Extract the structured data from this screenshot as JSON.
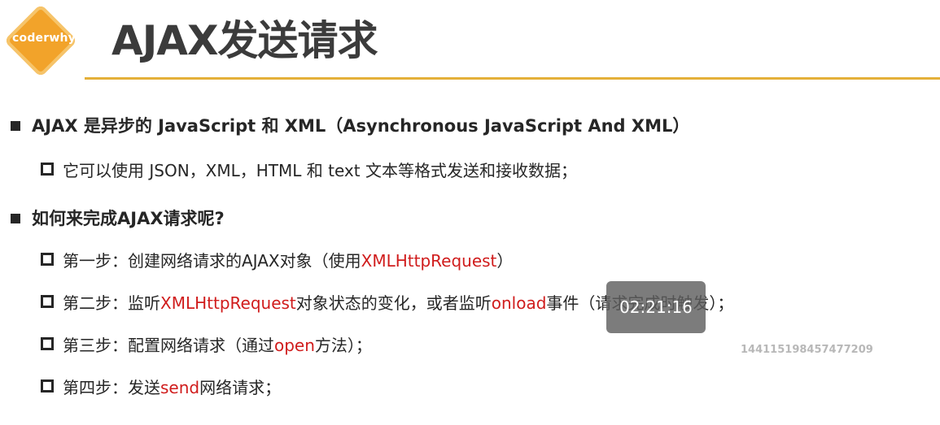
{
  "logo": {
    "text": "coderwhy"
  },
  "title": "AJAX发送请求",
  "items": [
    {
      "level": 1,
      "parts": [
        {
          "text": "AJAX 是异步的 JavaScript 和 XML（Asynchronous JavaScript And XML）",
          "red": false
        }
      ]
    },
    {
      "level": 2,
      "parts": [
        {
          "text": "它可以使用 JSON，XML，HTML 和 text 文本等格式发送和接收数据；",
          "red": false
        }
      ]
    },
    {
      "level": 1,
      "parts": [
        {
          "text": "如何来完成AJAX请求呢?",
          "red": false
        }
      ]
    },
    {
      "level": 2,
      "parts": [
        {
          "text": "第一步：创建网络请求的AJAX对象（使用",
          "red": false
        },
        {
          "text": "XMLHttpRequest",
          "red": true
        },
        {
          "text": "）",
          "red": false
        }
      ]
    },
    {
      "level": 2,
      "parts": [
        {
          "text": "第二步：监听",
          "red": false
        },
        {
          "text": "XMLHttpRequest",
          "red": true
        },
        {
          "text": "对象状态的变化，或者监听",
          "red": false
        },
        {
          "text": "onload",
          "red": true
        },
        {
          "text": "事件（请求完成时触发）；",
          "red": false
        }
      ]
    },
    {
      "level": 2,
      "parts": [
        {
          "text": "第三步：配置网络请求（通过",
          "red": false
        },
        {
          "text": "open",
          "red": true
        },
        {
          "text": "方法）；",
          "red": false
        }
      ]
    },
    {
      "level": 2,
      "parts": [
        {
          "text": "第四步：发送",
          "red": false
        },
        {
          "text": "send",
          "red": true
        },
        {
          "text": "网络请求；",
          "red": false
        }
      ]
    }
  ],
  "overlay": {
    "timer": "02:21:16",
    "watermark": "144115198457477209"
  },
  "colors": {
    "accent": "#e4b039",
    "logo": "#f2a32a",
    "highlight": "#d01c1c"
  }
}
